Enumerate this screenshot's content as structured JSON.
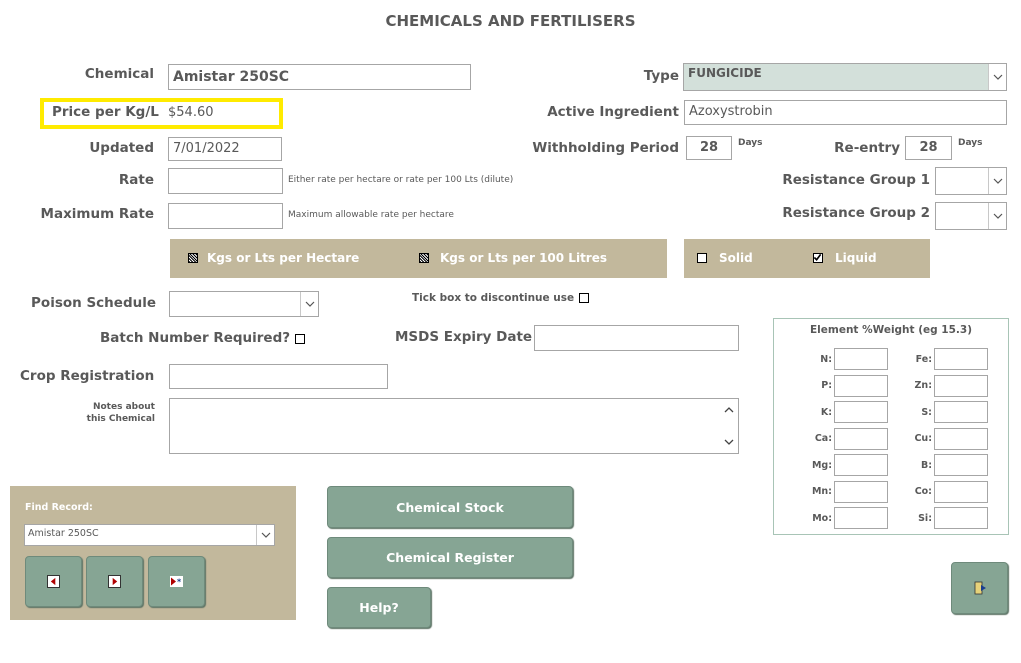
{
  "title": "CHEMICALS AND FERTILISERS",
  "chemical": {
    "label": "Chemical",
    "value": "Amistar 250SC"
  },
  "price": {
    "label": "Price per Kg/L",
    "value": "$54.60"
  },
  "updated": {
    "label": "Updated",
    "value": "7/01/2022"
  },
  "rate": {
    "label": "Rate",
    "hint": "Either rate per hectare or rate per 100 Lts (dilute)"
  },
  "max_rate": {
    "label": "Maximum Rate",
    "hint": "Maximum allowable rate per hectare"
  },
  "type": {
    "label": "Type",
    "value": "FUNGICIDE"
  },
  "active_ingredient": {
    "label": "Active Ingredient",
    "value": "Azoxystrobin"
  },
  "withholding": {
    "label": "Withholding Period",
    "value": "28",
    "unit": "Days"
  },
  "reentry": {
    "label": "Re-entry",
    "value": "28",
    "unit": "Days"
  },
  "resistance1": {
    "label": "Resistance Group 1"
  },
  "resistance2": {
    "label": "Resistance Group 2"
  },
  "rate_options": {
    "per_hectare": "Kgs or Lts per Hectare",
    "per_100l": "Kgs or Lts per 100 Litres"
  },
  "form": {
    "solid": "Solid",
    "liquid": "Liquid",
    "solid_checked": false,
    "liquid_checked": true
  },
  "poison": {
    "label": "Poison Schedule"
  },
  "discontinue": {
    "label": "Tick box to discontinue use"
  },
  "batch": {
    "label": "Batch Number Required?"
  },
  "msds": {
    "label": "MSDS Expiry Date"
  },
  "crop_reg": {
    "label": "Crop Registration"
  },
  "notes": {
    "label_line1": "Notes about",
    "label_line2": "this Chemical"
  },
  "elements": {
    "title": "Element %Weight (eg 15.3)",
    "left": [
      "N:",
      "P:",
      "K:",
      "Ca:",
      "Mg:",
      "Mn:",
      "Mo:"
    ],
    "right": [
      "Fe:",
      "Zn:",
      "S:",
      "Cu:",
      "B:",
      "Co:",
      "Si:"
    ]
  },
  "find": {
    "label": "Find Record:",
    "value": "Amistar 250SC"
  },
  "buttons": {
    "stock": "Chemical Stock",
    "register": "Chemical Register",
    "help": "Help?"
  },
  "colors": {
    "band": "#c2b89c",
    "button": "#86a594",
    "highlight": "#ffeb00",
    "type_field": "#d3e0da"
  }
}
